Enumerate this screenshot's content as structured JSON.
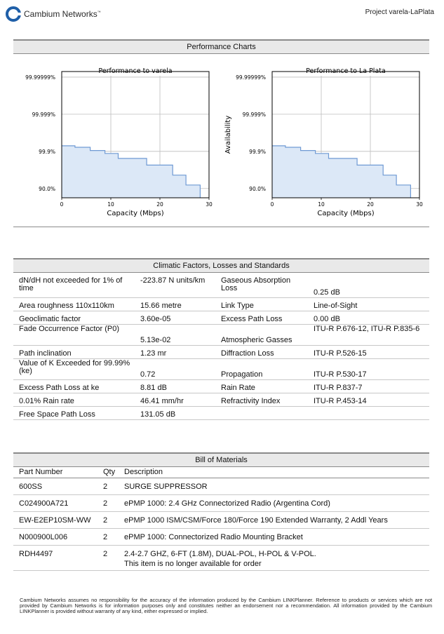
{
  "header": {
    "brand": "Cambium Networks",
    "trademark": "™",
    "project": "Project varela-LaPlata"
  },
  "performance": {
    "heading": "Performance Charts"
  },
  "chart_data": [
    {
      "type": "area",
      "title": "Performance to varela",
      "xlabel": "Capacity (Mbps)",
      "ylabel": "",
      "xlim": [
        0,
        30
      ],
      "xticks": [
        "0",
        "10",
        "20",
        "30"
      ],
      "yticks": [
        "99.99999%",
        "99.999%",
        "99.9%",
        "90.0%"
      ],
      "grid": true,
      "x": [
        0,
        2.7,
        5.8,
        8.8,
        11.5,
        17.3,
        22.6,
        25.3,
        28.2
      ],
      "y": [
        99.95,
        99.94,
        99.91,
        99.87,
        99.76,
        99.45,
        98.1,
        93.5,
        90.0
      ]
    },
    {
      "type": "area",
      "title": "Performance to La Plata",
      "xlabel": "Capacity (Mbps)",
      "ylabel": "Availability",
      "xlim": [
        0,
        30
      ],
      "xticks": [
        "0",
        "10",
        "20",
        "30"
      ],
      "yticks": [
        "99.99999%",
        "99.999%",
        "99.9%",
        "90.0%"
      ],
      "grid": true,
      "x": [
        0,
        2.7,
        5.8,
        8.8,
        11.5,
        17.3,
        22.6,
        25.3,
        28.2
      ],
      "y": [
        99.95,
        99.94,
        99.91,
        99.87,
        99.76,
        99.45,
        98.1,
        93.5,
        90.0
      ]
    }
  ],
  "climate": {
    "heading": "Climatic Factors, Losses and Standards",
    "rows": [
      [
        "dN/dH not exceeded for 1% of time",
        "-223.87 N units/km",
        "Gaseous Absorption Loss",
        "0.25 dB"
      ],
      [
        "Area roughness 110x110km",
        "15.66 metre",
        "Link Type",
        "Line-of-Sight"
      ],
      [
        "Geoclimatic factor",
        "3.60e-05",
        "Excess Path Loss",
        "0.00 dB"
      ],
      [
        "Fade Occurrence Factor (P0)",
        "5.13e-02",
        "Atmospheric Gasses",
        "ITU-R P.676-12, ITU-R P.835-6"
      ],
      [
        "Path inclination",
        "1.23 mr",
        "Diffraction Loss",
        "ITU-R P.526-15"
      ],
      [
        "Value of K Exceeded for 99.99% (ke)",
        "0.72",
        "Propagation",
        "ITU-R P.530-17"
      ],
      [
        "Excess Path Loss at ke",
        "8.81 dB",
        "Rain Rate",
        "ITU-R P.837-7"
      ],
      [
        "0.01% Rain rate",
        "46.41 mm/hr",
        "Refractivity Index",
        "ITU-R P.453-14"
      ],
      [
        "Free Space Path Loss",
        "131.05 dB",
        "",
        ""
      ]
    ]
  },
  "bom": {
    "heading": "Bill of Materials",
    "columns": [
      "Part Number",
      "Qty",
      "Description"
    ],
    "rows": [
      [
        "600SS",
        "2",
        "SURGE SUPPRESSOR",
        ""
      ],
      [
        "C024900A721",
        "2",
        "ePMP 1000: 2.4 GHz Connectorized Radio (Argentina Cord)",
        ""
      ],
      [
        "EW-E2EP10SM-WW",
        "2",
        "ePMP 1000 ISM/CSM/Force 180/Force 190 Extended Warranty, 2 Addl Years",
        ""
      ],
      [
        "N000900L006",
        "2",
        "ePMP 1000: Connectorized Radio Mounting Bracket",
        ""
      ],
      [
        "RDH4497",
        "2",
        "2.4-2.7 GHZ, 6-FT (1.8M), DUAL-POL, H-POL & V-POL.",
        "This item is no longer available for order"
      ]
    ]
  },
  "footer": {
    "disclaimer": "Cambium Networks assumes no responsibility for the accuracy of the information produced by the Cambium LINKPlanner. Reference to products or services which are not provided by Cambium Networks is for information purposes only and constitutes neither an endorsement nor a recommendation. All information provided by the Cambium LINKPlanner is provided without warranty of any kind, either expressed or implied."
  },
  "colors": {
    "area_fill": "#dce8f7",
    "area_line": "#6f9ad4",
    "header_bg": "#e9e9e9",
    "logo_blue": "#1f5fa8"
  }
}
